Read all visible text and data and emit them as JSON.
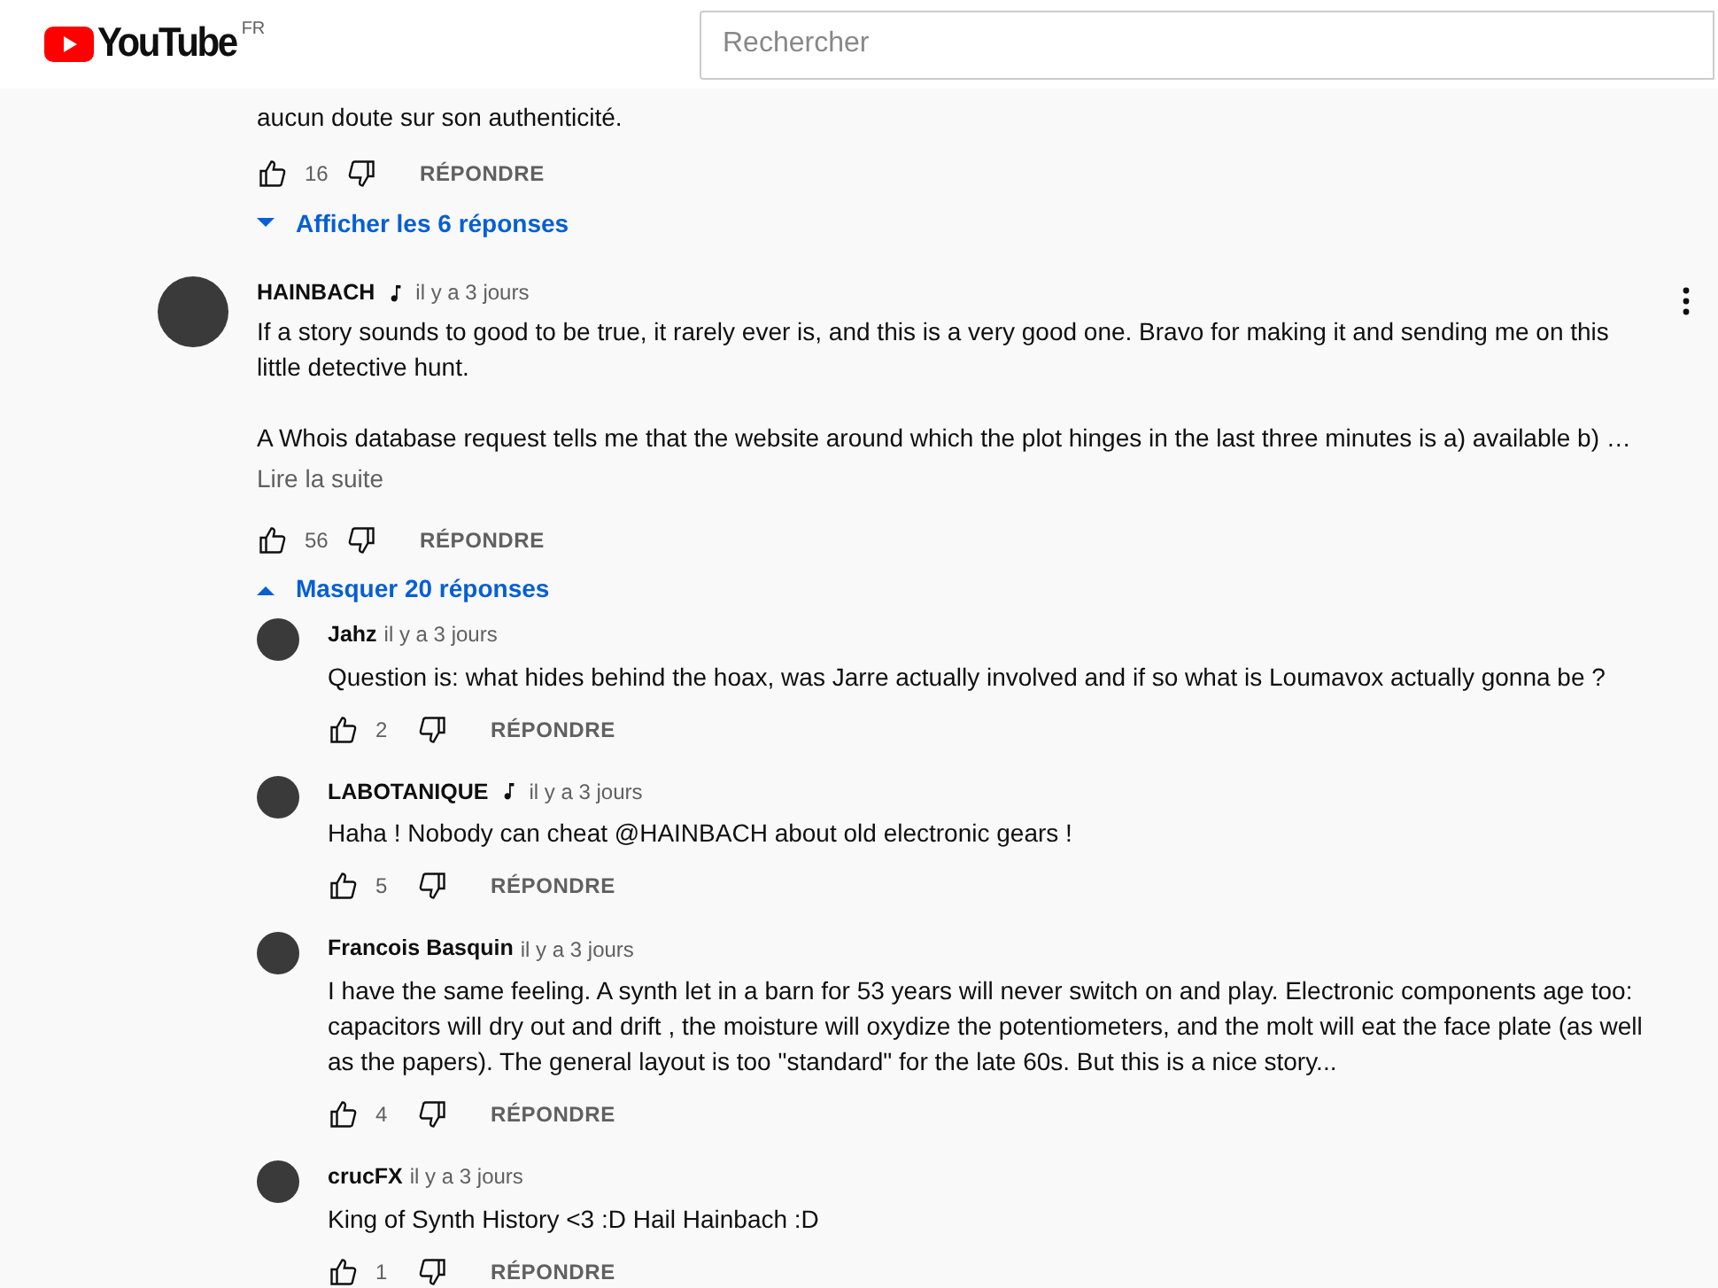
{
  "header": {
    "logo_text": "YouTube",
    "region": "FR",
    "search": {
      "placeholder": "Rechercher"
    }
  },
  "comments": [
    {
      "kind": "partial",
      "paragraphs": [
        "aucun doute sur son authenticité."
      ],
      "likes": "16",
      "reply_label": "RÉPONDRE",
      "replies_toggle": {
        "label": "Afficher les 6 réponses",
        "expanded": false
      }
    },
    {
      "kind": "full",
      "author": "HAINBACH",
      "music_badge": true,
      "time": "il y a 3 jours",
      "paragraphs": [
        "If a story sounds to good to be true, it rarely ever is, and this is a very good one. Bravo for making it and sending me on this little detective hunt.",
        "A Whois database request tells me that the website around which the plot hinges in the last three minutes is a) available b) …"
      ],
      "read_more": "Lire la suite",
      "likes": "56",
      "reply_label": "RÉPONDRE",
      "replies_toggle": {
        "label": "Masquer 20 réponses",
        "expanded": true
      },
      "replies": [
        {
          "author": "Jahz",
          "music_badge": false,
          "time": "il y a 3 jours",
          "text": "Question is: what hides behind the hoax, was Jarre actually involved and if so what is Loumavox actually gonna be ?",
          "likes": "2",
          "reply_label": "RÉPONDRE"
        },
        {
          "author": "LABOTANIQUE",
          "music_badge": true,
          "time": "il y a 3 jours",
          "text": "Haha ! Nobody can cheat @HAINBACH about old electronic gears !",
          "likes": "5",
          "reply_label": "RÉPONDRE"
        },
        {
          "author": "Francois Basquin",
          "music_badge": false,
          "time": "il y a 3 jours",
          "text": "I have the same feeling. A synth let in a barn for 53 years will never switch on and play. Electronic components age too: capacitors will dry out and drift , the moisture will oxydize the potentiometers, and the molt will eat the face plate (as well as the papers). The general layout is too \"standard\" for the late 60s. But this is a nice story...",
          "likes": "4",
          "reply_label": "RÉPONDRE"
        },
        {
          "author": "crucFX",
          "music_badge": false,
          "time": "il y a 3 jours",
          "text": "King of Synth History <3 :D Hail Hainbach :D",
          "likes": "1",
          "reply_label": "RÉPONDRE"
        }
      ]
    }
  ]
}
